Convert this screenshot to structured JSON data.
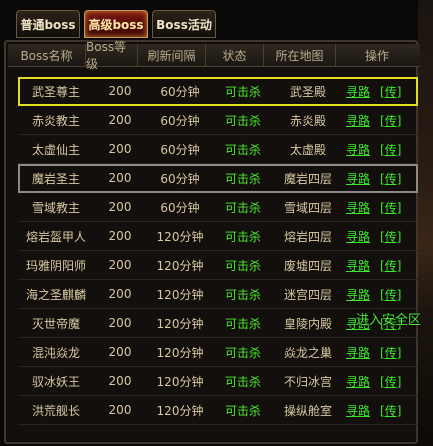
{
  "tabs": [
    {
      "label": "普通boss",
      "active": false
    },
    {
      "label": "高级boss",
      "active": true
    },
    {
      "label": "Boss活动",
      "active": false
    }
  ],
  "table": {
    "headers": [
      "Boss名称",
      "Boss等级",
      "刷新间隔",
      "状态",
      "所在地图",
      "操作"
    ],
    "rows": [
      {
        "name": "武圣尊主",
        "level": "200",
        "interval": "60分钟",
        "status": "可击杀",
        "map": "武圣殿",
        "action1": "寻路",
        "action2": "[传]"
      },
      {
        "name": "赤炎教主",
        "level": "200",
        "interval": "60分钟",
        "status": "可击杀",
        "map": "赤炎殿",
        "action1": "寻路",
        "action2": "[传]"
      },
      {
        "name": "太虚仙主",
        "level": "200",
        "interval": "60分钟",
        "status": "可击杀",
        "map": "太虚殿",
        "action1": "寻路",
        "action2": "[传]"
      },
      {
        "name": "魔岩圣主",
        "level": "200",
        "interval": "60分钟",
        "status": "可击杀",
        "map": "魔岩四层",
        "action1": "寻路",
        "action2": "[传]"
      },
      {
        "name": "雪域教主",
        "level": "200",
        "interval": "60分钟",
        "status": "可击杀",
        "map": "雪域四层",
        "action1": "寻路",
        "action2": "[传]"
      },
      {
        "name": "熔岩盔甲人",
        "level": "200",
        "interval": "120分钟",
        "status": "可击杀",
        "map": "熔岩四层",
        "action1": "寻路",
        "action2": "[传]"
      },
      {
        "name": "玛雅阴阳师",
        "level": "200",
        "interval": "120分钟",
        "status": "可击杀",
        "map": "废墟四层",
        "action1": "寻路",
        "action2": "[传]"
      },
      {
        "name": "海之圣麒麟",
        "level": "200",
        "interval": "120分钟",
        "status": "可击杀",
        "map": "迷宫四层",
        "action1": "寻路",
        "action2": "[传]"
      },
      {
        "name": "灭世帝魔",
        "level": "200",
        "interval": "120分钟",
        "status": "可击杀",
        "map": "皇陵内殿",
        "action1": "寻路",
        "action2": "[传]"
      },
      {
        "name": "混沌焱龙",
        "level": "200",
        "interval": "120分钟",
        "status": "可击杀",
        "map": "焱龙之巢",
        "action1": "寻路",
        "action2": "[传]"
      },
      {
        "name": "驭冰妖王",
        "level": "200",
        "interval": "120分钟",
        "status": "可击杀",
        "map": "不归冰宫",
        "action1": "寻路",
        "action2": "[传]"
      },
      {
        "name": "洪荒舰长",
        "level": "200",
        "interval": "120分钟",
        "status": "可击杀",
        "map": "操纵舱室",
        "action1": "寻路",
        "action2": "[传]"
      }
    ]
  },
  "toast": "进入安全区",
  "colors": {
    "status_green": "#4dea2e",
    "selected_yellow": "#e3df20",
    "hover_gray": "#8c8a86",
    "active_tab": "#7a1512"
  }
}
